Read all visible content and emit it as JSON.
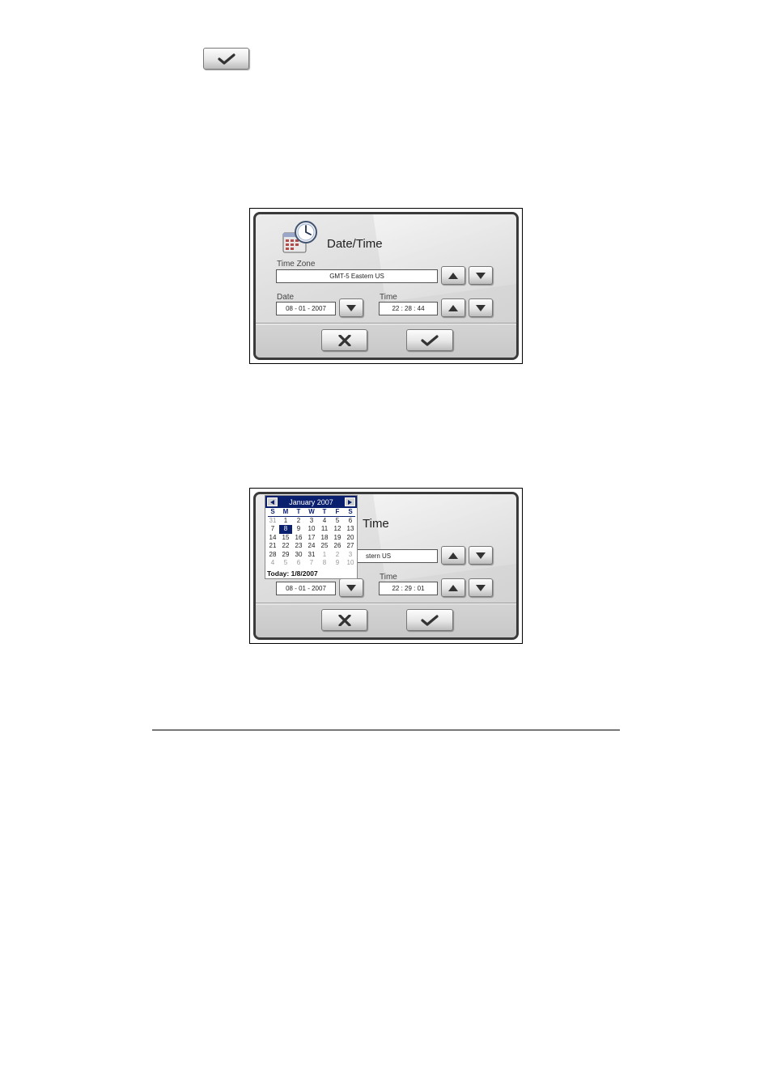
{
  "icons": {
    "check": "checkmark-icon",
    "cross": "close-icon",
    "up": "arrow-up-icon",
    "down": "arrow-down-icon",
    "app": "date-time-icon"
  },
  "colors": {
    "calendar_header": "#0a1f6e",
    "selected_day": "#0a1f6e"
  },
  "dialog1": {
    "title": "Date/Time",
    "time_zone_label": "Time Zone",
    "time_zone_value": "GMT-5 Eastern US",
    "date_label": "Date",
    "date_value": "08 - 01 - 2007",
    "time_label": "Time",
    "time_value": "22 : 28 : 44"
  },
  "dialog2": {
    "title_visible": "Time",
    "time_zone_visible": "stern US",
    "date_value": "08 - 01 - 2007",
    "time_label": "Time",
    "time_value": "22 : 29 : 01",
    "calendar": {
      "month_year": "January 2007",
      "weekdays": [
        "S",
        "M",
        "T",
        "W",
        "T",
        "F",
        "S"
      ],
      "days": [
        {
          "d": "31",
          "other": true
        },
        {
          "d": "1"
        },
        {
          "d": "2"
        },
        {
          "d": "3"
        },
        {
          "d": "4"
        },
        {
          "d": "5"
        },
        {
          "d": "6"
        },
        {
          "d": "7"
        },
        {
          "d": "8",
          "sel": true
        },
        {
          "d": "9"
        },
        {
          "d": "10"
        },
        {
          "d": "11"
        },
        {
          "d": "12"
        },
        {
          "d": "13"
        },
        {
          "d": "14"
        },
        {
          "d": "15"
        },
        {
          "d": "16"
        },
        {
          "d": "17"
        },
        {
          "d": "18"
        },
        {
          "d": "19"
        },
        {
          "d": "20"
        },
        {
          "d": "21"
        },
        {
          "d": "22"
        },
        {
          "d": "23"
        },
        {
          "d": "24"
        },
        {
          "d": "25"
        },
        {
          "d": "26"
        },
        {
          "d": "27"
        },
        {
          "d": "28"
        },
        {
          "d": "29"
        },
        {
          "d": "30"
        },
        {
          "d": "31"
        },
        {
          "d": "1",
          "other": true
        },
        {
          "d": "2",
          "other": true
        },
        {
          "d": "3",
          "other": true
        },
        {
          "d": "4",
          "other": true
        },
        {
          "d": "5",
          "other": true
        },
        {
          "d": "6",
          "other": true
        },
        {
          "d": "7",
          "other": true
        },
        {
          "d": "8",
          "other": true
        },
        {
          "d": "9",
          "other": true
        },
        {
          "d": "10",
          "other": true
        }
      ],
      "today_label": "Today: 1/8/2007"
    }
  }
}
